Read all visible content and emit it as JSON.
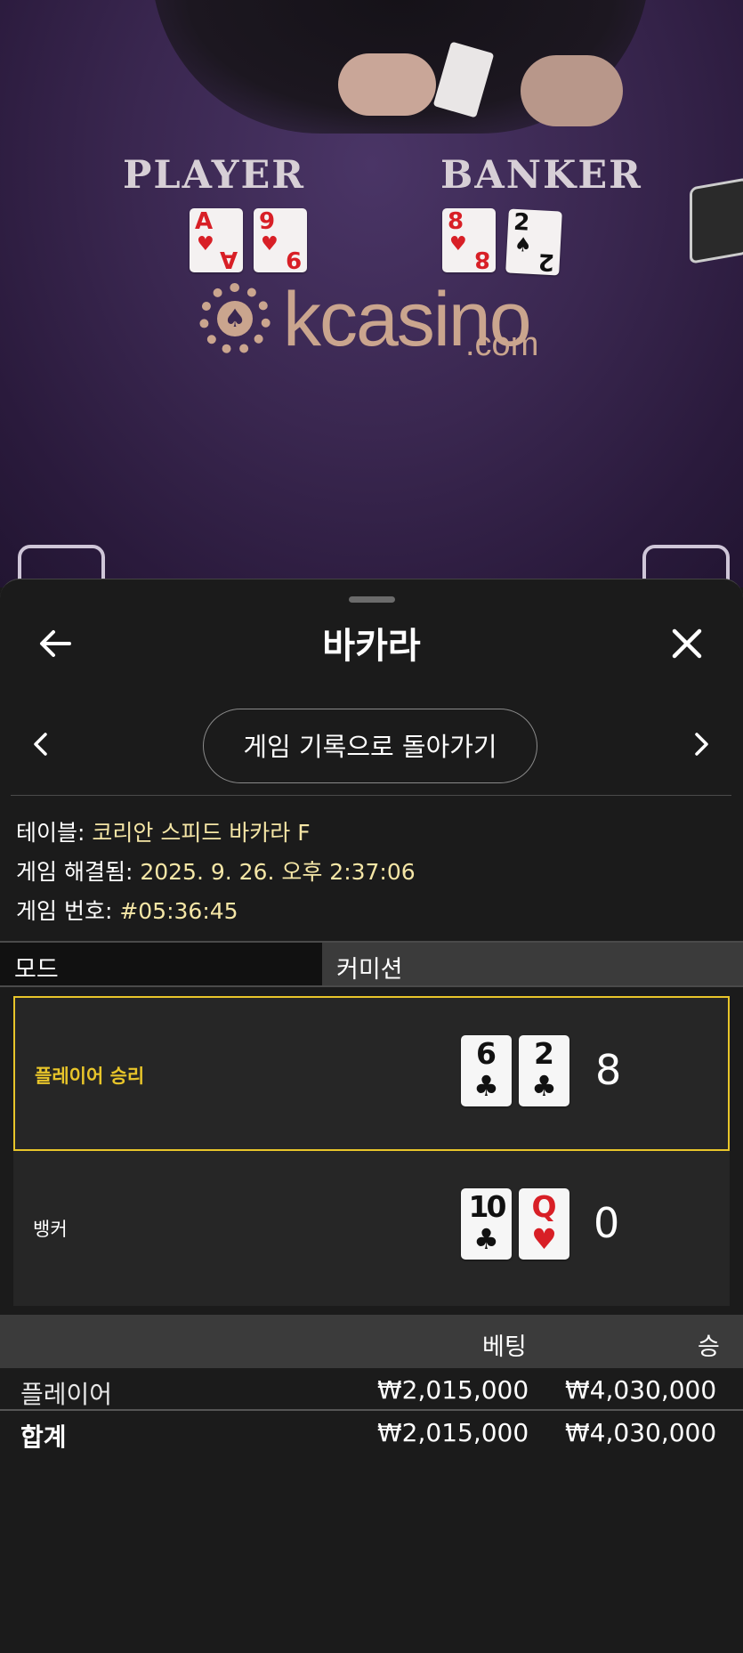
{
  "table_view": {
    "player_label": "PLAYER",
    "banker_label": "BANKER",
    "player_cards": [
      {
        "rank": "A",
        "suit": "♥",
        "color": "red"
      },
      {
        "rank": "9",
        "suit": "♥",
        "color": "red"
      }
    ],
    "banker_cards": [
      {
        "rank": "8",
        "suit": "♥",
        "color": "red"
      },
      {
        "rank": "2",
        "suit": "♠",
        "color": "black"
      }
    ],
    "logo_text": "kcasino",
    "logo_sub": ".com"
  },
  "header": {
    "title": "바카라",
    "back_icon": "arrow-left-icon",
    "close_icon": "close-icon"
  },
  "nav": {
    "back_to_history": "게임 기록으로 돌아가기",
    "prev": "‹",
    "next": "›"
  },
  "details": {
    "table_label": "테이블:",
    "table_value": "코리안 스피드 바카라 F",
    "resolved_label": "게임 해결됨:",
    "resolved_value": "2025. 9. 26. 오후 2:37:06",
    "game_no_label": "게임 번호:",
    "game_no_value": "#05:36:45"
  },
  "mode": {
    "label": "모드",
    "value": "커미션"
  },
  "results": [
    {
      "label": "플레이어 승리",
      "winner": true,
      "cards": [
        {
          "rank": "6",
          "suit": "♣",
          "color": "black"
        },
        {
          "rank": "2",
          "suit": "♣",
          "color": "black"
        }
      ],
      "score": "8"
    },
    {
      "label": "뱅커",
      "winner": false,
      "cards": [
        {
          "rank": "10",
          "suit": "♣",
          "color": "black"
        },
        {
          "rank": "Q",
          "suit": "♥",
          "color": "red"
        }
      ],
      "score": "0"
    }
  ],
  "bets_table": {
    "headers": {
      "bet": "베팅",
      "win": "승"
    },
    "rows": [
      {
        "name": "플레이어",
        "bet": "₩2,015,000",
        "win": "₩4,030,000"
      }
    ],
    "total": {
      "name": "합계",
      "bet": "₩2,015,000",
      "win": "₩4,030,000"
    }
  },
  "colors": {
    "accent": "#e8c52a",
    "value_text": "#f5e6a6",
    "card_red": "#d81f26"
  }
}
